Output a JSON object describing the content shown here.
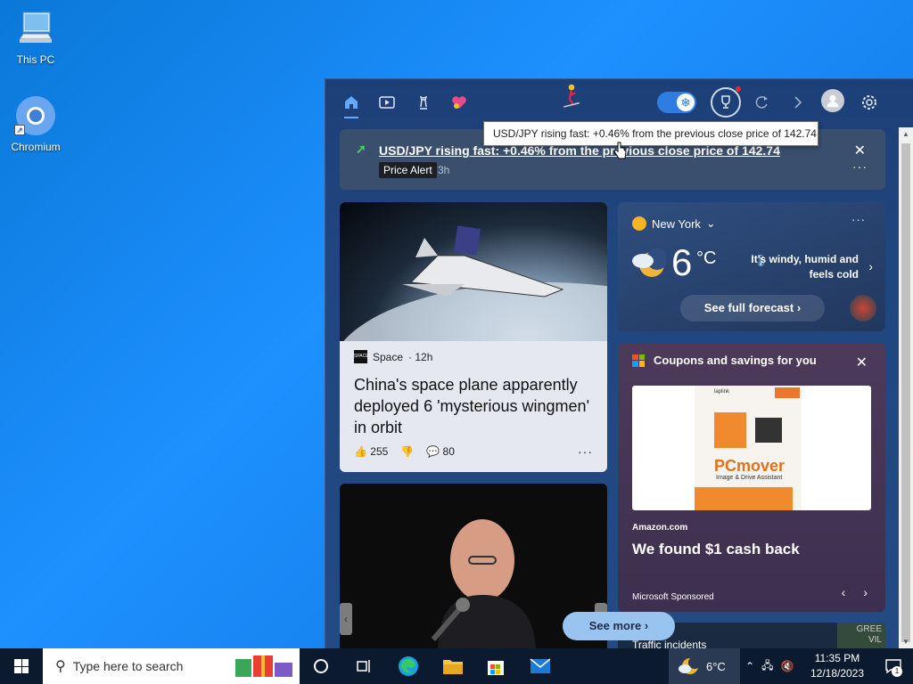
{
  "desktop": {
    "icons": [
      {
        "label": "This PC"
      },
      {
        "label": "Chromium"
      }
    ]
  },
  "toolbar": {
    "active_tab": "home"
  },
  "alert": {
    "headline": "USD/JPY rising fast: +0.46% from the previous close price of 142.74",
    "badge": "Price Alert",
    "time": "3h"
  },
  "tooltip": {
    "text": "USD/JPY rising fast: +0.46% from the previous close price of 142.74"
  },
  "news": {
    "source": "Space",
    "age": "· 12h",
    "title": "China's space plane apparently deployed 6 'mysterious wingmen' in orbit",
    "likes": "255",
    "comments": "80"
  },
  "weather": {
    "location": "New York",
    "temperature": "6",
    "unit": "°C",
    "description": "It's windy, humid and feels cold",
    "forecast_button": "See full forecast"
  },
  "coupons": {
    "header": "Coupons and savings for you",
    "ad_brand": "PCmover",
    "ad_sub": "Image & Drive Assistant",
    "ad_small": "laplink",
    "seller": "Amazon.com",
    "title": "We found $1 cash back",
    "sponsor": "Microsoft Sponsored"
  },
  "traffic": {
    "title": "Traffic incidents",
    "map_text": "GREE VIL"
  },
  "see_more": "See more",
  "taskbar": {
    "search_placeholder": "Type here to search",
    "weather_temp": "6°C",
    "time": "11:35 PM",
    "date": "12/18/2023",
    "notifications": "1"
  },
  "colors": {
    "accent": "#2d7ee0",
    "price_up": "#47d16b"
  }
}
